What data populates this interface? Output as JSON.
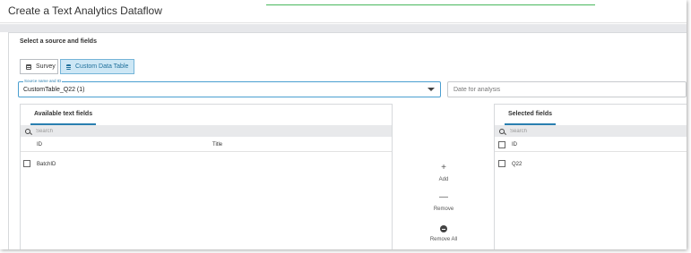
{
  "dialog": {
    "title": "Create a Text Analytics Dataflow"
  },
  "section": {
    "title": "Select a source and fields"
  },
  "source_type": {
    "survey_label": "Survey",
    "custom_label": "Custom Data Table",
    "selected": "Custom Data Table"
  },
  "source_select": {
    "legend": "Source name and ID",
    "value": "CustomTable_Q22 (1)"
  },
  "date_field": {
    "placeholder": "Date for analysis"
  },
  "available_panel": {
    "tab_label": "Available text fields",
    "search_placeholder": "Search",
    "columns": [
      "ID",
      "Title"
    ],
    "rows": [
      {
        "id": "BatchID",
        "title": ""
      }
    ]
  },
  "actions": {
    "add_glyph": "+",
    "add_label": "Add",
    "remove_glyph": "—",
    "remove_label": "Remove",
    "remove_all_label": "Remove All"
  },
  "selected_panel": {
    "tab_label": "Selected fields",
    "search_placeholder": "Search",
    "columns": [
      "ID"
    ],
    "rows": [
      {
        "id": "Q22"
      }
    ]
  },
  "colors": {
    "accent": "#2a7fb0",
    "selected_button_bg": "#cde7f5",
    "progress": "#49b85d"
  }
}
